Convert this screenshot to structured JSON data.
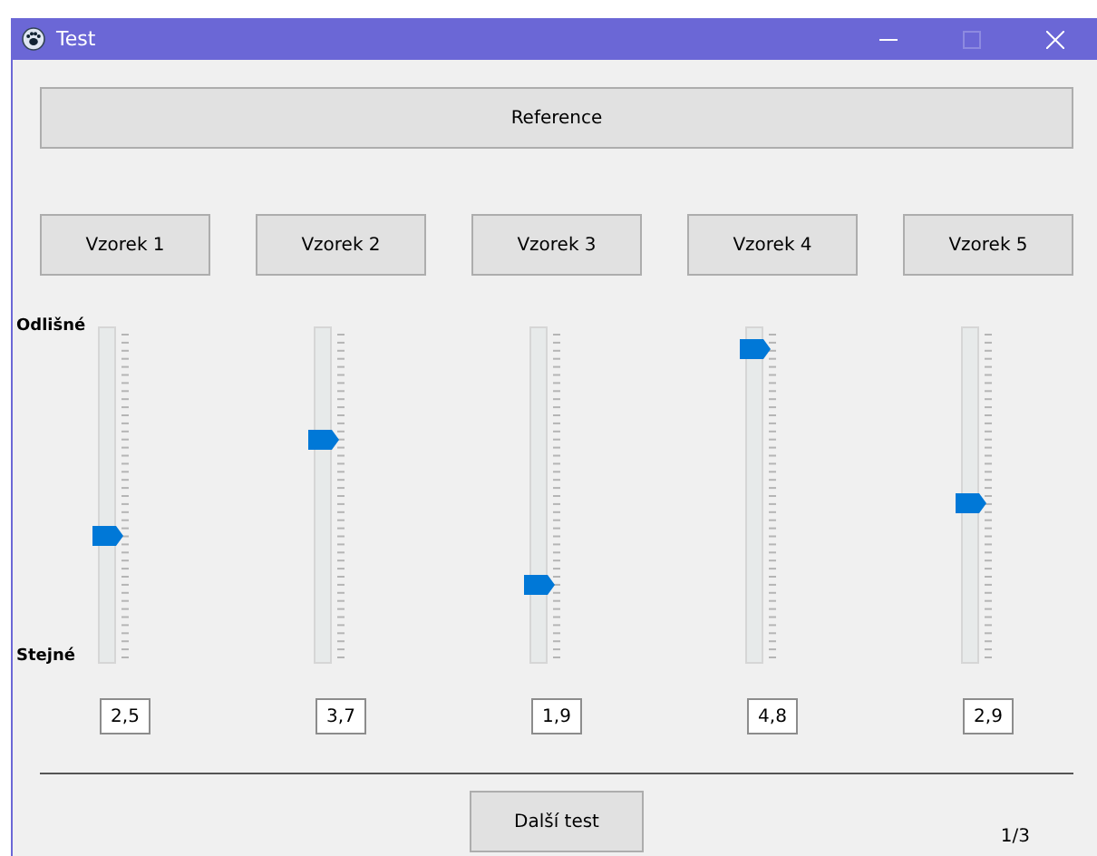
{
  "window": {
    "title": "Test",
    "maximize_disabled": true
  },
  "reference_button": "Reference",
  "scale": {
    "top": "Odlišné",
    "bottom": "Stejné"
  },
  "samples": [
    {
      "label": "Vzorek 1",
      "level": 0.375,
      "value": "2,5"
    },
    {
      "label": "Vzorek 2",
      "level": 0.675,
      "value": "3,7"
    },
    {
      "label": "Vzorek 3",
      "level": 0.225,
      "value": "1,9"
    },
    {
      "label": "Vzorek 4",
      "level": 0.95,
      "value": "4,8"
    },
    {
      "label": "Vzorek 5",
      "level": 0.475,
      "value": "2,9"
    }
  ],
  "next_button": "Další test",
  "progress": "1/3"
}
